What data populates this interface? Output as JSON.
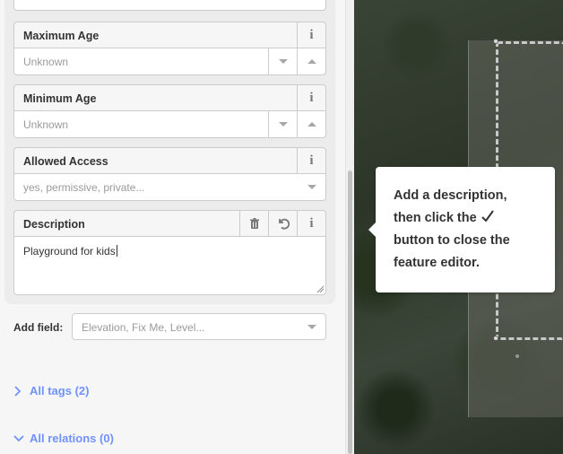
{
  "fields": [
    {
      "label": "Maximum Age",
      "placeholder": "Unknown",
      "type": "number"
    },
    {
      "label": "Minimum Age",
      "placeholder": "Unknown",
      "type": "number"
    },
    {
      "label": "Allowed Access",
      "placeholder": "yes, permissive, private...",
      "type": "combo"
    },
    {
      "label": "Description",
      "value": "Playground for kids",
      "type": "textarea"
    }
  ],
  "add_field": {
    "label": "Add field:",
    "placeholder": "Elevation, Fix Me, Level..."
  },
  "sections": {
    "all_tags": "All tags (2)",
    "all_relations": "All relations (0)"
  },
  "tooltip": {
    "line1": "Add a description,",
    "line2a": "then click the",
    "line3": "button to close the",
    "line4": "feature editor."
  },
  "icons": {
    "info": "info-icon",
    "trash": "trash-icon",
    "undo": "undo-icon",
    "check": "checkmark-icon",
    "chevron": "chevron-icon"
  },
  "colors": {
    "link": "#7092ff",
    "panel": "#f6f6f6",
    "border": "#cccccc"
  }
}
